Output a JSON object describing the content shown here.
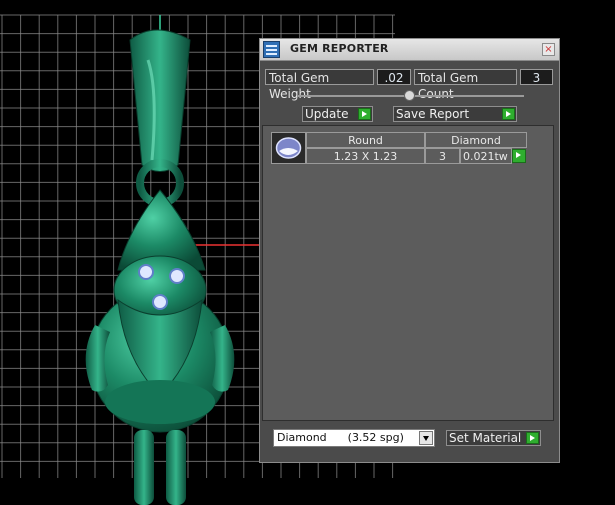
{
  "window": {
    "title": "GEM REPORTER",
    "close_glyph": "×",
    "icon": "gem-reporter-app-icon"
  },
  "stats": {
    "total_weight_label": "Total Gem Weight",
    "total_weight_value": ".02",
    "total_count_label": "Total Gem Count",
    "total_count_value": "3"
  },
  "toolbar": {
    "update_label": "Update",
    "save_report_label": "Save Report"
  },
  "table": {
    "headers": [
      "Round",
      "Diamond"
    ],
    "rows": [
      {
        "size": "1.23 X 1.23",
        "count": "3",
        "weight": "0.021tw"
      }
    ]
  },
  "footer": {
    "material_value": "Diamond      (3.52 spg)",
    "set_material_label": "Set Material"
  },
  "colors": {
    "model": "#1f8f6a",
    "grid": "#8a8a8a",
    "accent_green": "#2fae2f",
    "panel_bg": "#4b4b4b"
  }
}
